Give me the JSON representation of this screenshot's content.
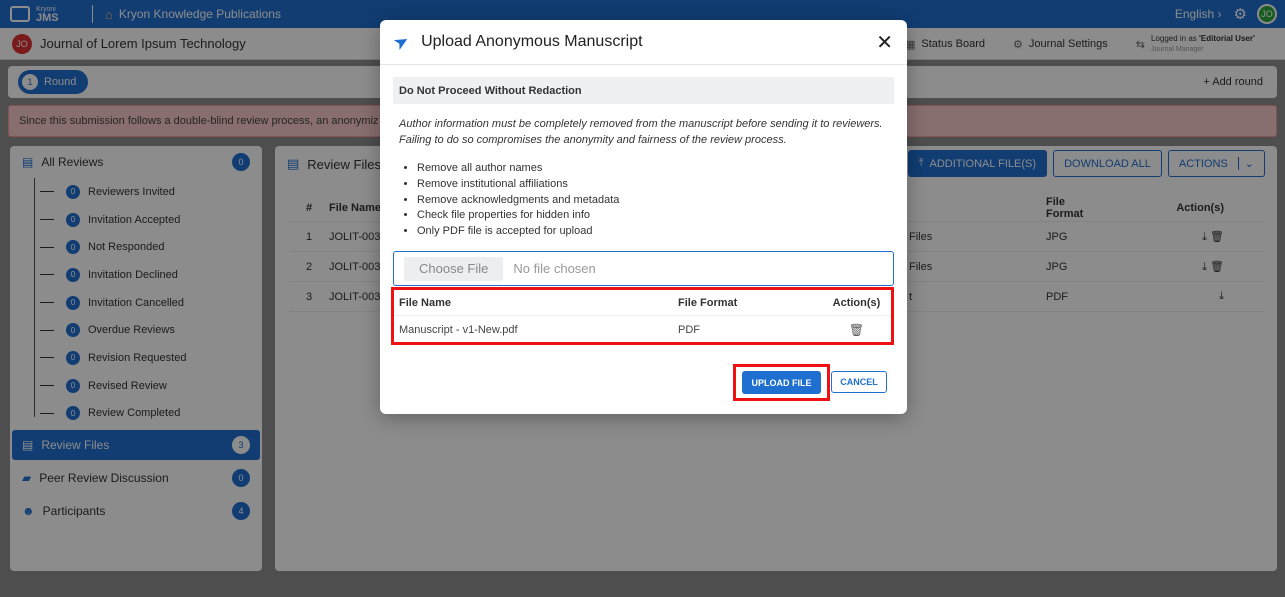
{
  "app": {
    "logo_small": "Kryoni",
    "logo_big": "JMS",
    "publisher": "Kryon Knowledge Publications",
    "language": "English",
    "user_initials": "JO"
  },
  "subheader": {
    "journal_initials": "JO",
    "journal_title": "Journal of Lorem Ipsum Technology",
    "status_board": "Status Board",
    "journal_settings": "Journal Settings",
    "logged_in_prefix": "Logged in as ",
    "logged_in_user": "'Editorial User'",
    "logged_in_role": "Journal Manager"
  },
  "round": {
    "number": "1",
    "label": "Round",
    "add_round": "+ Add round"
  },
  "alert": {
    "text": "Since this submission follows a double-blind review process, an anonymiz"
  },
  "sidebar": {
    "all_reviews": {
      "label": "All Reviews",
      "count": "0"
    },
    "sub_items": [
      {
        "label": "Reviewers Invited",
        "count": "0"
      },
      {
        "label": "Invitation Accepted",
        "count": "0"
      },
      {
        "label": "Not Responded",
        "count": "0"
      },
      {
        "label": "Invitation Declined",
        "count": "0"
      },
      {
        "label": "Invitation Cancelled",
        "count": "0"
      },
      {
        "label": "Overdue Reviews",
        "count": "0"
      },
      {
        "label": "Revision Requested",
        "count": "0"
      },
      {
        "label": "Revised Review",
        "count": "0"
      },
      {
        "label": "Review Completed",
        "count": "0"
      }
    ],
    "review_files": {
      "label": "Review Files",
      "count": "3"
    },
    "peer_discussion": {
      "label": "Peer Review Discussion",
      "count": "0"
    },
    "participants": {
      "label": "Participants",
      "count": "4"
    }
  },
  "main": {
    "title": "Review Files",
    "additional_files": "ADDITIONAL FILE(S)",
    "download_all": "DOWNLOAD ALL",
    "actions": "ACTIONS",
    "columns": {
      "num": "#",
      "name": "File Name",
      "format": "File Format",
      "action": "Action(s)"
    },
    "rows": [
      {
        "num": "1",
        "name": "JOLIT-003",
        "files": "Files",
        "format": "JPG"
      },
      {
        "num": "2",
        "name": "JOLIT-003",
        "files": "Files",
        "format": "JPG"
      },
      {
        "num": "3",
        "name": "JOLIT-003",
        "files": "t",
        "format": "PDF"
      }
    ]
  },
  "modal": {
    "title": "Upload Anonymous Manuscript",
    "warning_title": "Do Not Proceed Without Redaction",
    "warning_text": "Author information must be completely removed from the manuscript before sending it to reviewers. Failing to do so compromises the anonymity and fairness of the review process.",
    "rules": [
      "Remove all author names",
      "Remove institutional affiliations",
      "Remove acknowledgments and metadata",
      "Check file properties for hidden info",
      "Only PDF file is accepted for upload"
    ],
    "choose_file": "Choose File",
    "no_file": "No file chosen",
    "table": {
      "col_name": "File Name",
      "col_format": "File Format",
      "col_action": "Action(s)",
      "rows": [
        {
          "name": "Manuscript - v1-New.pdf",
          "format": "PDF"
        }
      ]
    },
    "upload": "UPLOAD FILE",
    "cancel": "CANCEL"
  }
}
